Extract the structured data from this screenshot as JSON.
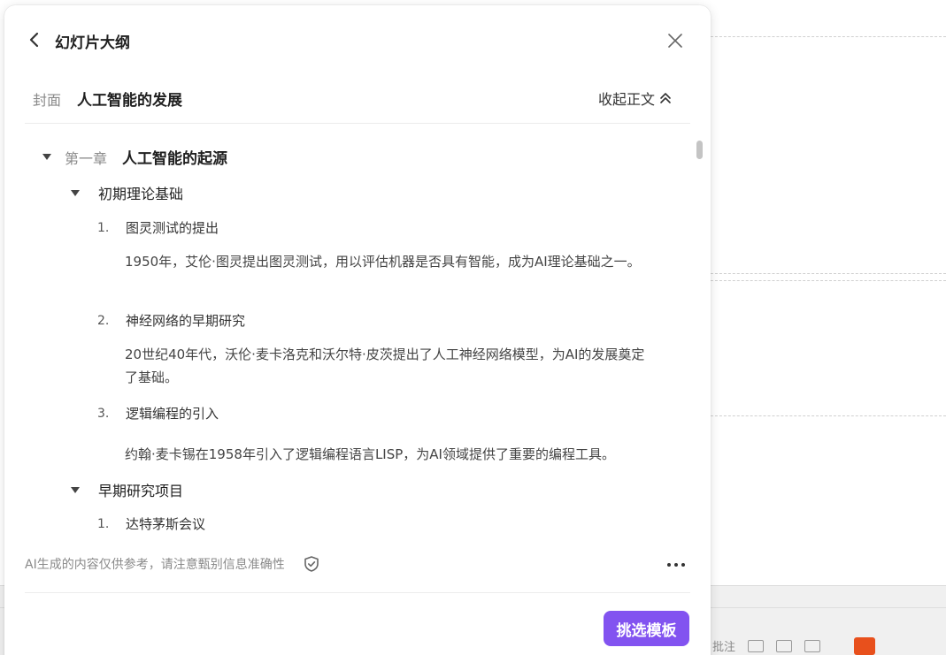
{
  "panel": {
    "title": "幻灯片大纲",
    "cover_label": "封面",
    "cover_title": "人工智能的发展",
    "collapse_label": "收起正文"
  },
  "outline": {
    "chapter_label": "第一章",
    "chapter_title": "人工智能的起源",
    "sections": [
      {
        "title": "初期理论基础",
        "items": [
          {
            "num": "1.",
            "title": "图灵测试的提出",
            "body": "1950年，艾伦·图灵提出图灵测试，用以评估机器是否具有智能，成为AI理论基础之一。"
          },
          {
            "num": "2.",
            "title": "神经网络的早期研究",
            "body": "20世纪40年代，沃伦·麦卡洛克和沃尔特·皮茨提出了人工神经网络模型，为AI的发展奠定了基础。"
          },
          {
            "num": "3.",
            "title": "逻辑编程的引入",
            "body": "约翰·麦卡锡在1958年引入了逻辑编程语言LISP，为AI领域提供了重要的编程工具。"
          }
        ]
      },
      {
        "title": "早期研究项目",
        "items": [
          {
            "num": "1.",
            "title": "达特茅斯会议"
          }
        ]
      }
    ]
  },
  "footer": {
    "disclaimer": "AI生成的内容仅供参考，请注意甄别信息准确性",
    "pick_template": "挑选模板"
  },
  "background": {
    "status_text": "批注"
  },
  "colors": {
    "accent": "#8253f0",
    "muted_text": "#8a8a8a",
    "play_button": "#e8501c"
  },
  "icons": [
    "back-arrow-icon",
    "close-icon",
    "double-chevron-up-icon",
    "collapse-triangle-icon",
    "shield-check-icon",
    "more-dots-icon"
  ]
}
